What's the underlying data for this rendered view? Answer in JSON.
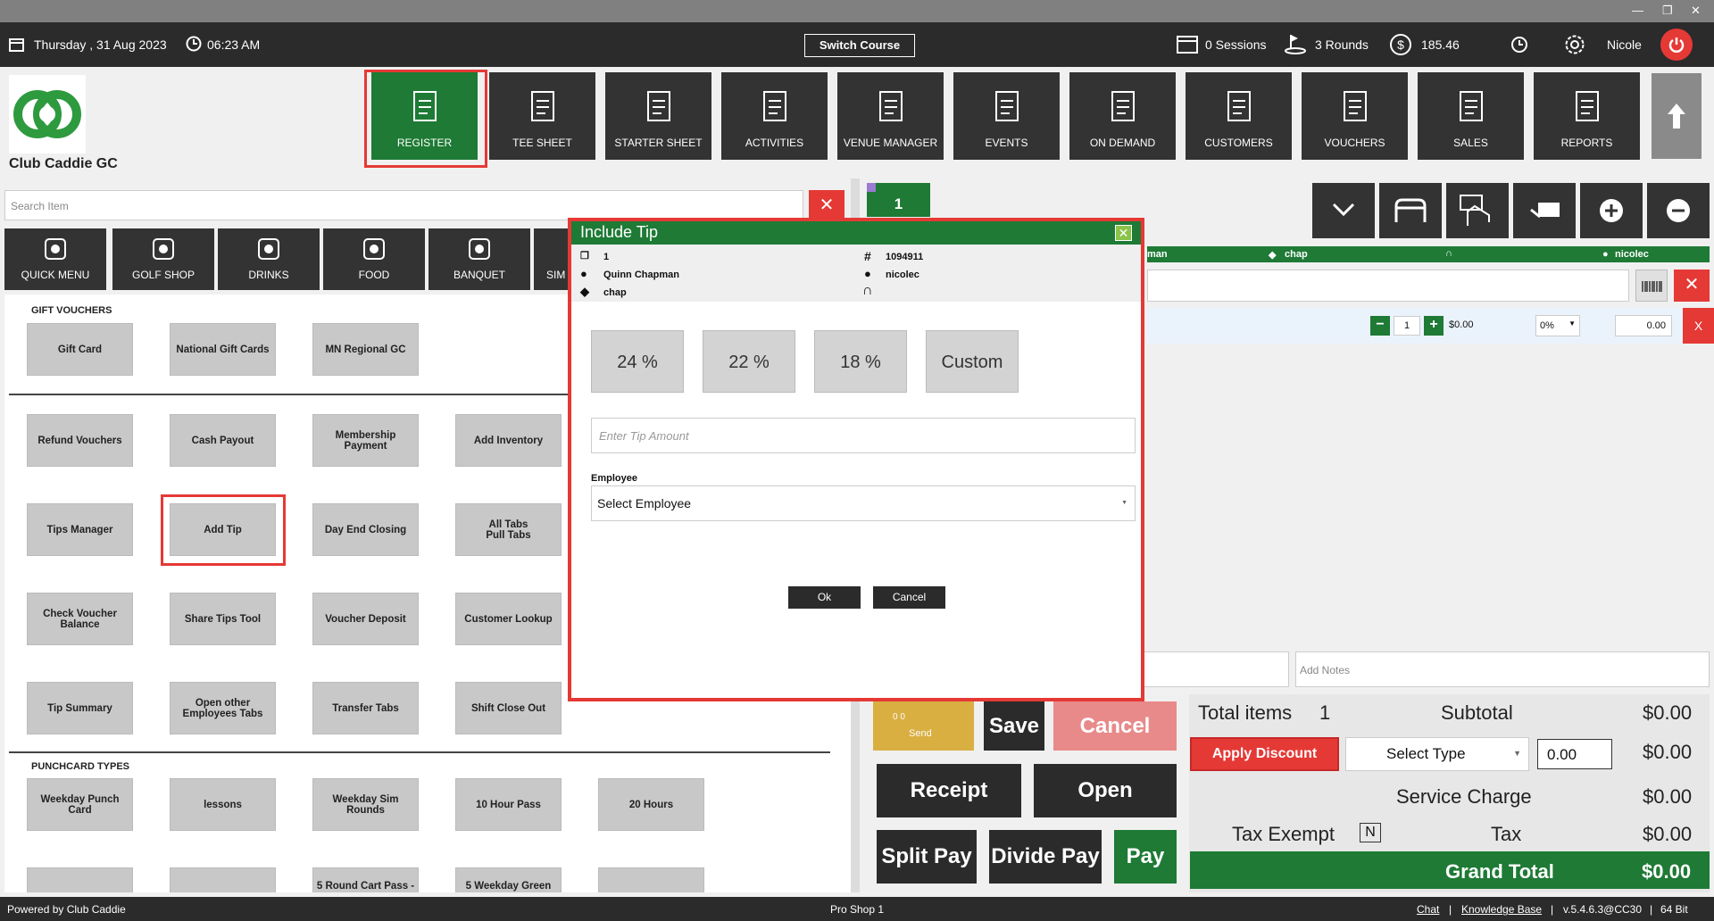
{
  "window": {
    "minimize": "—",
    "restore": "❐",
    "close": "✕"
  },
  "topbar": {
    "date": "Thursday , 31 Aug 2023",
    "time": "06:23 AM",
    "switch_course": "Switch Course",
    "sessions": "0 Sessions",
    "rounds": "3 Rounds",
    "balance": "185.46",
    "user": "Nicole"
  },
  "brand": {
    "club_name": "Club Caddie GC",
    "brand_color": "#1e7a35"
  },
  "nav": [
    {
      "label": "REGISTER",
      "icon": "barcode-scanner-icon",
      "active": true
    },
    {
      "label": "TEE SHEET",
      "icon": "tee-sheet-icon"
    },
    {
      "label": "STARTER SHEET",
      "icon": "tablet-icon"
    },
    {
      "label": "ACTIVITIES",
      "icon": "activities-icon"
    },
    {
      "label": "VENUE MANAGER",
      "icon": "venue-icon"
    },
    {
      "label": "EVENTS",
      "icon": "calendar-icon"
    },
    {
      "label": "ON DEMAND",
      "icon": "mobile-icon"
    },
    {
      "label": "CUSTOMERS",
      "icon": "customers-icon"
    },
    {
      "label": "VOUCHERS",
      "icon": "vouchers-icon"
    },
    {
      "label": "SALES",
      "icon": "sales-icon"
    },
    {
      "label": "REPORTS",
      "icon": "reports-icon"
    }
  ],
  "search": {
    "placeholder": "Search Item"
  },
  "categories": [
    {
      "label": "QUICK MENU"
    },
    {
      "label": "GOLF SHOP"
    },
    {
      "label": "DRINKS"
    },
    {
      "label": "FOOD"
    },
    {
      "label": "BANQUET"
    },
    {
      "label": "SIM"
    }
  ],
  "items": {
    "gift_title": "GIFT VOUCHERS",
    "gift": [
      "Gift Card",
      "National Gift Cards",
      "MN Regional GC"
    ],
    "row1": [
      "Refund Vouchers",
      "Cash Payout",
      "Membership Payment",
      "Add Inventory"
    ],
    "row2": [
      "Tips Manager",
      "Add Tip",
      "Day End Closing",
      "All Tabs\nPull Tabs"
    ],
    "row3": [
      "Check Voucher\nBalance",
      "Share Tips Tool",
      "Voucher Deposit",
      "Customer Lookup"
    ],
    "row4": [
      "Tip Summary",
      "Open other\nEmployees Tabs",
      "Transfer Tabs",
      "Shift Close Out"
    ],
    "punch_title": "PUNCHCARD TYPES",
    "punch": [
      "Weekday Punch Card",
      "lessons",
      "Weekday Sim Rounds",
      "10 Hour Pass",
      "20 Hours"
    ],
    "partial": [
      "",
      "",
      "5 Round Cart Pass -",
      "5 Weekday Green",
      ""
    ]
  },
  "order": {
    "tab_number": "1",
    "header_name_partial": "man",
    "header_tag": "chap",
    "header_user": "nicolec",
    "qty": "1",
    "line_price": "$0.00",
    "discount_pct": "0%",
    "line_amount": "0.00",
    "notes_placeholder": "Add Notes"
  },
  "actions": {
    "send": "Send",
    "send_counts": "0    0",
    "save": "Save",
    "cancel": "Cancel",
    "receipt": "Receipt",
    "open": "Open",
    "split_pay": "Split Pay",
    "divide_pay": "Divide Pay",
    "pay": "Pay"
  },
  "totals": {
    "total_items_label": "Total items",
    "total_items": "1",
    "subtotal_label": "Subtotal",
    "subtotal": "$0.00",
    "apply_discount": "Apply Discount",
    "select_type": "Select Type",
    "discount_value": "0.00",
    "discount_amount": "$0.00",
    "service_charge_label": "Service Charge",
    "service_charge": "$0.00",
    "tax_exempt_label": "Tax Exempt",
    "tax_exempt_flag": "N",
    "tax_label": "Tax",
    "tax": "$0.00",
    "grand_total_label": "Grand Total",
    "grand_total": "$0.00"
  },
  "dialog": {
    "title": "Include Tip",
    "order_no": "1",
    "ticket_no": "1094911",
    "customer": "Quinn  Chapman",
    "employee_user": "nicolec",
    "tag": "chap",
    "tip_options": [
      "24 %",
      "22 %",
      "18 %",
      "Custom"
    ],
    "tip_placeholder": "Enter Tip Amount",
    "employee_label": "Employee",
    "employee_select": "Select Employee",
    "ok": "Ok",
    "cancel": "Cancel"
  },
  "footer": {
    "powered": "Powered by Club Caddie",
    "station": "Pro Shop 1",
    "chat": "Chat",
    "kb": "Knowledge Base",
    "version": "v.5.4.6.3@CC30",
    "bits": "64 Bit",
    "sep": "|"
  }
}
